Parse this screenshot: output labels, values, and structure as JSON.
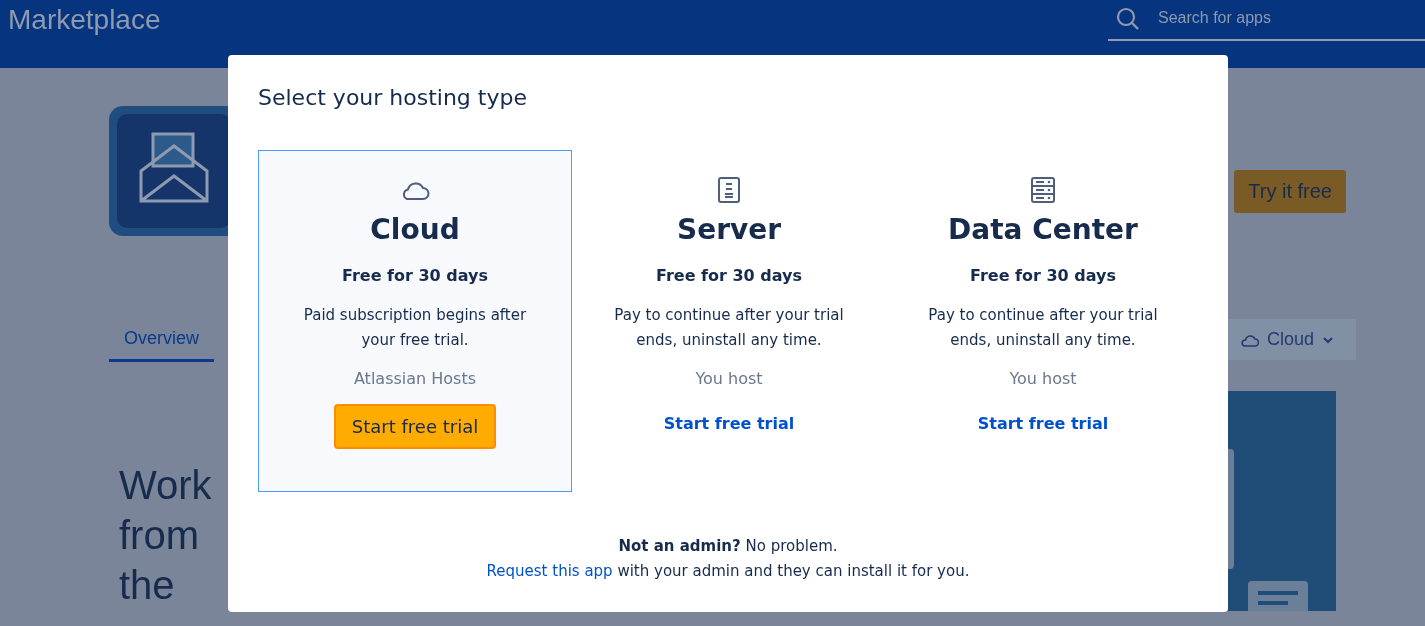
{
  "header": {
    "title": "Marketplace",
    "search": {
      "placeholder": "Search for apps"
    }
  },
  "app": {
    "try_button": "Try it free"
  },
  "tabs": [
    {
      "label": "Overview",
      "selected": true
    }
  ],
  "hosting_dropdown": {
    "label": "Cloud"
  },
  "headline_lines": [
    "Work",
    "from",
    "the"
  ],
  "modal": {
    "title": "Select your hosting type",
    "options": [
      {
        "kind": "cloud",
        "name": "Cloud",
        "trial": "Free for 30 days",
        "description": "Paid subscription begins after your free trial.",
        "host": "Atlassian Hosts",
        "action": "Start free trial",
        "selected": true
      },
      {
        "kind": "server",
        "name": "Server",
        "trial": "Free for 30 days",
        "description": "Pay to continue after your trial ends, uninstall any time.",
        "host": "You host",
        "action": "Start free trial",
        "selected": false
      },
      {
        "kind": "datacenter",
        "name": "Data Center",
        "trial": "Free for 30 days",
        "description": "Pay to continue after your trial ends, uninstall any time.",
        "host": "You host",
        "action": "Start free trial",
        "selected": false
      }
    ],
    "footer": {
      "question": "Not an admin?",
      "answer": "No problem.",
      "link": "Request this app",
      "rest": "with your admin and they can install it for you."
    }
  }
}
